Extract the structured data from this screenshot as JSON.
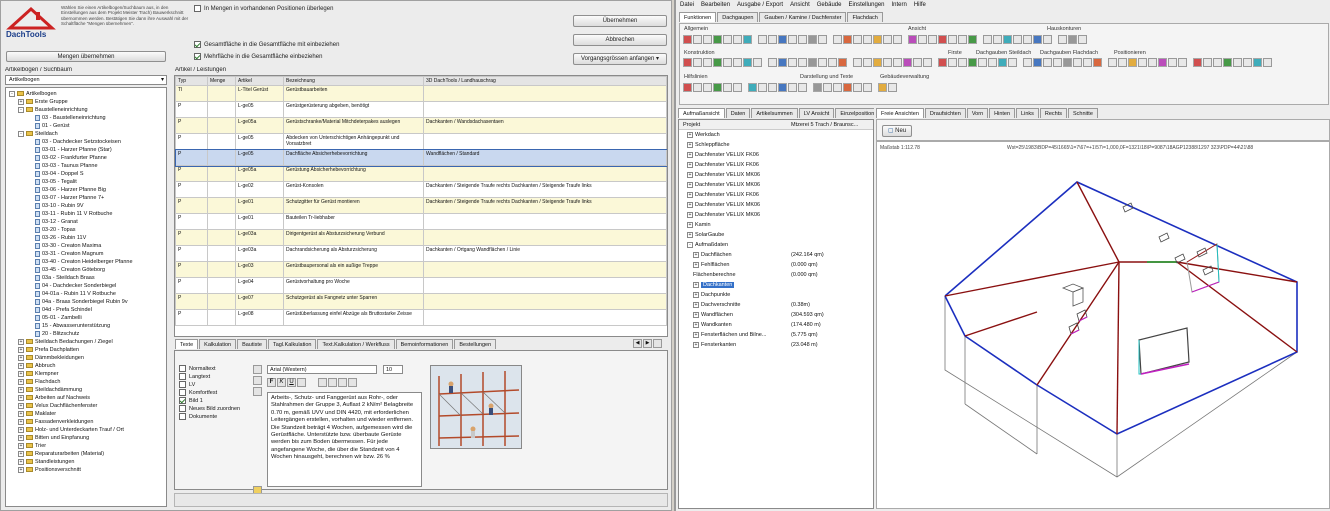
{
  "logo": {
    "text": "DachTools"
  },
  "top_left": {
    "instructions": "Wählen Sie einen Artikelbogen/Suchbaum aus, in den Einstellungen aus dem Projekt Meister Trach) Bauwerkschnitt übernommen werden. Bestätigen Sie dann ihre Auswahl mit der Schaltfläche \"Mengen übernehmen\".",
    "take_button": "Mengen übernehmen",
    "opt_zero": "In Mengen in vorhandenen Positionen überlegen",
    "opt_total": "Gesamtfläche in die Gesamtfläche mit einbeziehen",
    "opt_fillin": "Mehrfläche in die Gesamtfläche einbeziehen"
  },
  "right_buttons": {
    "apply": "Übernehmen",
    "cancel": "Abbrechen",
    "extra": "Vorgangsgrössen anfangen"
  },
  "catalog": {
    "header": "Artikelbogen / Suchbaum",
    "dropdown": "Artikelbogen",
    "tree": [
      {
        "label": "Artikelbogen",
        "level": 0,
        "kind": "folder",
        "exp": "-"
      },
      {
        "label": "Erste Gruppe",
        "level": 1,
        "kind": "folder",
        "exp": "+"
      },
      {
        "label": "Baustelleneinrichtung",
        "level": 1,
        "kind": "folder",
        "exp": "-"
      },
      {
        "label": "03 - Baustelleneinrichtung",
        "level": 2,
        "kind": "doc"
      },
      {
        "label": "01 - Gerüst",
        "level": 2,
        "kind": "doc"
      },
      {
        "label": "Steildach",
        "level": 1,
        "kind": "folder",
        "exp": "-"
      },
      {
        "label": "03 - Dachdecker Setzstockeisen",
        "level": 2,
        "kind": "doc"
      },
      {
        "label": "03-01 - Harzer Pfanne (Star)",
        "level": 2,
        "kind": "doc"
      },
      {
        "label": "03-02 - Frankfurter Pfanne",
        "level": 2,
        "kind": "doc"
      },
      {
        "label": "03-03 - Taunus Pfanne",
        "level": 2,
        "kind": "doc"
      },
      {
        "label": "03-04 - Doppel S",
        "level": 2,
        "kind": "doc"
      },
      {
        "label": "03-05 - Tegalit",
        "level": 2,
        "kind": "doc"
      },
      {
        "label": "03-06 - Harzer Pfanne Big",
        "level": 2,
        "kind": "doc"
      },
      {
        "label": "03-07 - Harzer Pfanne 7+",
        "level": 2,
        "kind": "doc"
      },
      {
        "label": "03-10 - Rubin 9V",
        "level": 2,
        "kind": "doc"
      },
      {
        "label": "03-11 - Rubin 11 V Rotbuche",
        "level": 2,
        "kind": "doc"
      },
      {
        "label": "03-12 - Granat",
        "level": 2,
        "kind": "doc"
      },
      {
        "label": "03-20 - Topas",
        "level": 2,
        "kind": "doc"
      },
      {
        "label": "03-26 - Rubin 11V",
        "level": 2,
        "kind": "doc"
      },
      {
        "label": "03-30 - Creaton Maxima",
        "level": 2,
        "kind": "doc"
      },
      {
        "label": "03-31 - Creaton Magnum",
        "level": 2,
        "kind": "doc"
      },
      {
        "label": "03-40 - Creaton Heidelberger Pfanne",
        "level": 2,
        "kind": "doc"
      },
      {
        "label": "03-45 - Creaton Göteborg",
        "level": 2,
        "kind": "doc"
      },
      {
        "label": "03a - Steildach Braas",
        "level": 2,
        "kind": "doc"
      },
      {
        "label": "04 - Dachdecker Sonderbiegel",
        "level": 2,
        "kind": "doc"
      },
      {
        "label": "04-01a - Rubin 11 V Rotbuche",
        "level": 2,
        "kind": "doc"
      },
      {
        "label": "04a - Braas Sonderbiegel Rubin 9v",
        "level": 2,
        "kind": "doc"
      },
      {
        "label": "04d - Prefa Schindel",
        "level": 2,
        "kind": "doc"
      },
      {
        "label": "05-01 - Zambelli",
        "level": 2,
        "kind": "doc"
      },
      {
        "label": "15 - Abwasserunterstützung",
        "level": 2,
        "kind": "doc"
      },
      {
        "label": "20 - Blitzschutz",
        "level": 2,
        "kind": "doc"
      },
      {
        "label": "Steildach Bedachungen / Ziegel",
        "level": 1,
        "kind": "folder",
        "exp": "+"
      },
      {
        "label": "Prefa Dachplatten",
        "level": 1,
        "kind": "folder",
        "exp": "+"
      },
      {
        "label": "Dämmbekleidungen",
        "level": 1,
        "kind": "folder",
        "exp": "+"
      },
      {
        "label": "Abbruch",
        "level": 1,
        "kind": "folder",
        "exp": "+"
      },
      {
        "label": "Klempner",
        "level": 1,
        "kind": "folder",
        "exp": "+"
      },
      {
        "label": "Flachdach",
        "level": 1,
        "kind": "folder",
        "exp": "+"
      },
      {
        "label": "Steildachdämmung",
        "level": 1,
        "kind": "folder",
        "exp": "+"
      },
      {
        "label": "Arbeiten auf Nachweis",
        "level": 1,
        "kind": "folder",
        "exp": "+"
      },
      {
        "label": "Velux Dachflächenfenster",
        "level": 1,
        "kind": "folder",
        "exp": "+"
      },
      {
        "label": "Maklater",
        "level": 1,
        "kind": "folder",
        "exp": "+"
      },
      {
        "label": "Fassadenverkleidungen",
        "level": 1,
        "kind": "folder",
        "exp": "+"
      },
      {
        "label": "Holz- und Unterdeckarten Trauf / Ort",
        "level": 1,
        "kind": "folder",
        "exp": "+"
      },
      {
        "label": "Bitten und Einpfanung",
        "level": 1,
        "kind": "folder",
        "exp": "+"
      },
      {
        "label": "Trier",
        "level": 1,
        "kind": "folder",
        "exp": "+"
      },
      {
        "label": "Reparaturarbeiten (Material)",
        "level": 1,
        "kind": "folder",
        "exp": "+"
      },
      {
        "label": "Standleistungen",
        "level": 1,
        "kind": "folder",
        "exp": "+"
      },
      {
        "label": "Positionsverschnitt",
        "level": 1,
        "kind": "folder",
        "exp": "+"
      }
    ]
  },
  "articles": {
    "header": "Artikel / Leistungen",
    "columns": [
      "Typ",
      "Menge",
      "Artikel",
      "Bezeichnung",
      "3D DachTools / Landhauschrag"
    ],
    "rows": [
      {
        "typ": "TI",
        "menge": "",
        "artikel": "L-Titel Gerüst",
        "bez": "Gerüstbauarbeiten",
        "dt": "",
        "hl": "y"
      },
      {
        "typ": "P",
        "menge": "",
        "artikel": "L-ge05",
        "bez": "Gerüstgerüsterung abgeben, benötigt",
        "dt": "",
        "hl": ""
      },
      {
        "typ": "P",
        "menge": "",
        "artikel": "L-ge05a",
        "bez": "Gerüstschranke/Material Mitchdeterpakes auslegen",
        "dt": "Dachkanten / Wandsdachasentaen",
        "hl": "y"
      },
      {
        "typ": "P",
        "menge": "",
        "artikel": "L-ge05",
        "bez": "Abdecken von Unterschichtigen Anhängepunkt und Vorsatzbret",
        "dt": "",
        "hl": ""
      },
      {
        "typ": "P",
        "menge": "",
        "artikel": "L-ge05",
        "bez": "Dachfläche Absicherhebevorrichtung",
        "dt": "Wandflächen / Standard",
        "hl": "sel"
      },
      {
        "typ": "P",
        "menge": "",
        "artikel": "L-ge05a",
        "bez": "Gerüstung Absicherhebevorrichtung",
        "dt": "",
        "hl": "y"
      },
      {
        "typ": "P",
        "menge": "",
        "artikel": "L-ge02",
        "bez": "Gerüst-Konsolen",
        "dt": "Dachkanten / Steigende Traufe rechts Dachkanten / Steigende Traufe links",
        "hl": ""
      },
      {
        "typ": "P",
        "menge": "",
        "artikel": "L-ge01",
        "bez": "Schutzgitter für Gerüst montieren",
        "dt": "Dachkanten / Steigende Traufe rechts Dachkanten / Steigende Traufe links",
        "hl": "y"
      },
      {
        "typ": "P",
        "menge": "",
        "artikel": "L-ge01",
        "bez": "Bauteilen Tr-liebhaber",
        "dt": "",
        "hl": ""
      },
      {
        "typ": "P",
        "menge": "",
        "artikel": "L-ge03a",
        "bez": "Dirigentgerüst als Absturzsicherung Verbund",
        "dt": "",
        "hl": "y"
      },
      {
        "typ": "P",
        "menge": "",
        "artikel": "L-ge03a",
        "bez": "Dachrandsicherung als Absturzsicherung",
        "dt": "Dachkanten / Ortgang Wandflächen / Linie",
        "hl": ""
      },
      {
        "typ": "P",
        "menge": "",
        "artikel": "L-ge03",
        "bez": "Gerüstbaupersonal als ein außige Treppe",
        "dt": "",
        "hl": "y"
      },
      {
        "typ": "P",
        "menge": "",
        "artikel": "L-ge04",
        "bez": "Gerüstvorhaltung pro Woche",
        "dt": "",
        "hl": ""
      },
      {
        "typ": "P",
        "menge": "",
        "artikel": "L-ge07",
        "bez": "Schutzgerüst als Fangnetz unter Sparren",
        "dt": "",
        "hl": "y"
      },
      {
        "typ": "P",
        "menge": "",
        "artikel": "L-ge08",
        "bez": "Gerüstüberlassung einfel Abzüge als Bruttostarke Zeisse",
        "dt": "",
        "hl": ""
      }
    ]
  },
  "lower_tabs": [
    "Texte",
    "Kalkulation",
    "Bautiste",
    "Tagl.Kalkulation",
    "Text.Kalkulation / Werkfluss",
    "Bemoinformationen",
    "Bestellungen"
  ],
  "text_types": [
    {
      "label": "Normaltext",
      "checked": false
    },
    {
      "label": "Langtext",
      "checked": false
    },
    {
      "label": "LV",
      "checked": false
    },
    {
      "label": "Komfortfest",
      "checked": false
    },
    {
      "label": "Bild 1",
      "checked": true
    },
    {
      "label": "Neues Bild zuordnen",
      "checked": false
    },
    {
      "label": "Dokumente",
      "checked": false
    }
  ],
  "editor": {
    "font": "Arial (Western)",
    "size": "10",
    "body": "Arbeits-, Schutz- und Fanggerüst aus Rohr-, oder Stahlrahmen der Gruppe 3, Auflast 2 kN/m² Belagbreite 0.70 m, gemäß UVV und DIN 4420, mit erforderlichen Leitergängen erstellen, vorhalten und wieder entfernen. Die Standzeit beträgt 4 Wochen, aufgemessen wird die Gerüstfläche. Unterstützte bzw. überbaute Gerüste werden bis zum Boden übermessen. Für jede angefangene Woche, die über die Standzeit von 4 Wochen hinausgeht, berechnen wir bzw. 26 %"
  },
  "cad": {
    "menu": [
      "Datei",
      "Bearbeiten",
      "Ausgabe / Export",
      "Ansicht",
      "Gebäude",
      "Einstellungen",
      "Intern",
      "Hilfe"
    ],
    "ribbon_tabs": [
      "Funktionen",
      "Dachgaupen",
      "Gauben / Kamine / Dachfenster",
      "Flachdach"
    ],
    "groups": [
      "Allgemein",
      "Ansicht",
      "Hauskonturen",
      "Konstruktion",
      "Firste",
      "Dachgauben Steildach",
      "Dachgauben Flachdach",
      "Positionieren",
      "Hilfslinien",
      "Darstellung und Texte",
      "Gebäudeverwaltung"
    ],
    "left_tabs": [
      "Aufmaßansicht",
      "Daten",
      "Artikelsummen",
      "LV Ansicht",
      "Einzelpositionen"
    ],
    "props_header": [
      "Projekt",
      "Mtzerei 5 Trach / Braunsc..."
    ],
    "props": [
      {
        "label": "Werkdach",
        "value": "",
        "exp": "+"
      },
      {
        "label": "Schleppfläche",
        "value": "",
        "exp": "+"
      },
      {
        "label": "Dachfenster VELUX FK06",
        "value": "",
        "exp": "+"
      },
      {
        "label": "Dachfenster VELUX FK06",
        "value": "",
        "exp": "+"
      },
      {
        "label": "Dachfenster VELUX MK06",
        "value": "",
        "exp": "+"
      },
      {
        "label": "Dachfenster VELUX MK06",
        "value": "",
        "exp": "+"
      },
      {
        "label": "Dachfenster VELUX FK06",
        "value": "",
        "exp": "+"
      },
      {
        "label": "Dachfenster VELUX MK06",
        "value": "",
        "exp": "+"
      },
      {
        "label": "Dachfenster VELUX MK06",
        "value": "",
        "exp": "+"
      },
      {
        "label": "Kamin",
        "value": "",
        "exp": "+"
      },
      {
        "label": "SolarGaube",
        "value": "",
        "exp": "+"
      },
      {
        "label": "Aufmaßdaten",
        "value": "",
        "exp": "-"
      },
      {
        "label": "Dachflächen",
        "value": "(242.164 qm)",
        "exp": "+"
      },
      {
        "label": "Fehlflächen",
        "value": "(0.000 qm)",
        "exp": "+"
      },
      {
        "label": "Flächenberechne",
        "value": "(0.000 qm)",
        "exp": ""
      },
      {
        "label": "Dachkanten",
        "value": "",
        "exp": "+",
        "sel": true
      },
      {
        "label": "Dachpunkte",
        "value": "",
        "exp": "+"
      },
      {
        "label": "Dachverschnitte",
        "value": "(0.38m)",
        "exp": "+"
      },
      {
        "label": "Wandflächen",
        "value": "(304.593 qm)",
        "exp": "+"
      },
      {
        "label": "Wandkanten",
        "value": "(174.480 m)",
        "exp": "+"
      },
      {
        "label": "Fensterflächen und Bilne...",
        "value": "(5.775 qm)",
        "exp": "+"
      },
      {
        "label": "Fensterkanten",
        "value": "(23.048 m)",
        "exp": "+"
      }
    ],
    "view_tabs": [
      "Freie Ansichten",
      "Draufsichten",
      "Vorn",
      "Hinten",
      "Links",
      "Rechts",
      "Schnitte"
    ],
    "new_button": "Neu",
    "status_left": "Maßstab 1:112.78",
    "status_right": "Wst=25\\1983\\BDP=45\\1665\\1=7\\67=+1\\57\\=1,000,0F=1321\\18\\P=9087\\18AGP12388\\1297 323\\PDP=44\\21\\88"
  }
}
